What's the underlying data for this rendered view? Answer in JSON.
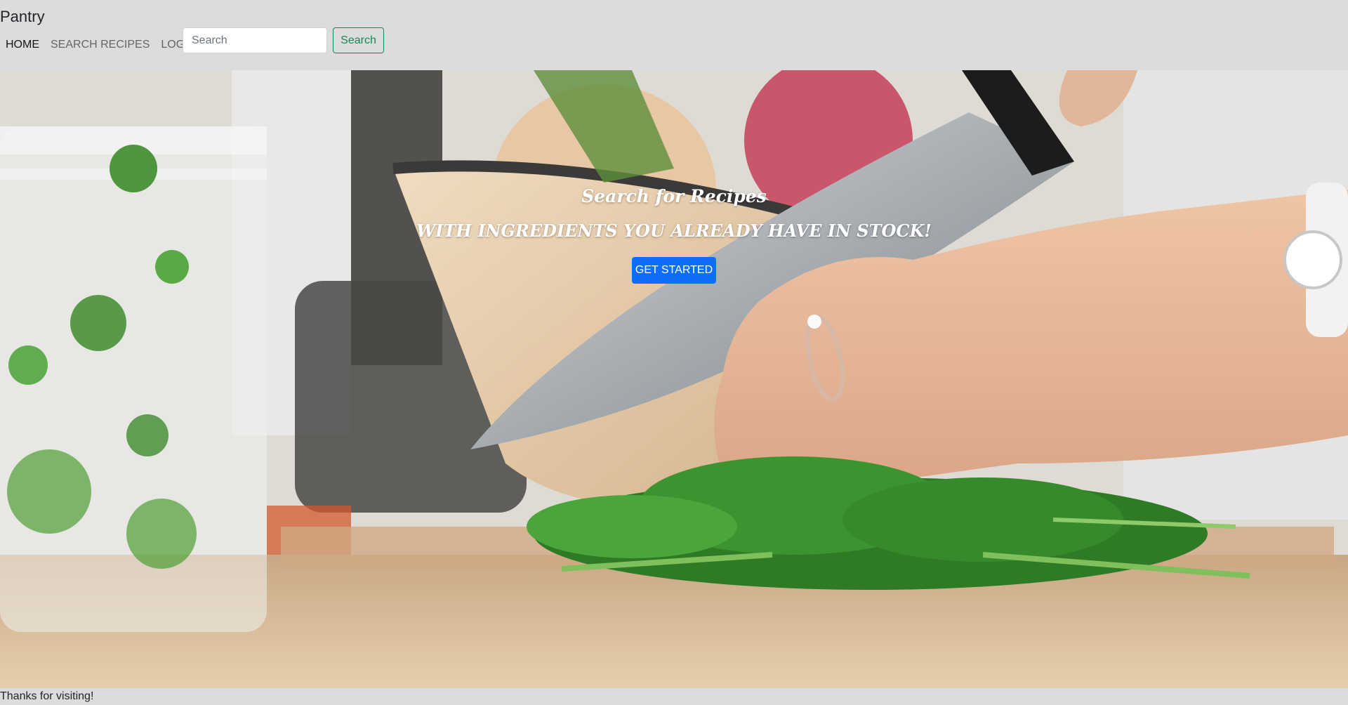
{
  "navbar": {
    "brand": "Pantry",
    "links": [
      {
        "label": "HOME"
      },
      {
        "label": "SEARCH RECIPES"
      },
      {
        "label": "LOGIN"
      }
    ],
    "search": {
      "placeholder": "Search",
      "value": "",
      "button_label": "Search"
    }
  },
  "hero": {
    "title": "Search for Recipes",
    "subtitle": "WITH INGREDIENTS YOU ALREADY HAVE IN STOCK!",
    "cta_label": "GET STARTED"
  },
  "footer": {
    "text": "Thanks for visiting!"
  },
  "colors": {
    "background": "#dcdcdc",
    "primary": "#0d6efd",
    "success": "#198754"
  }
}
